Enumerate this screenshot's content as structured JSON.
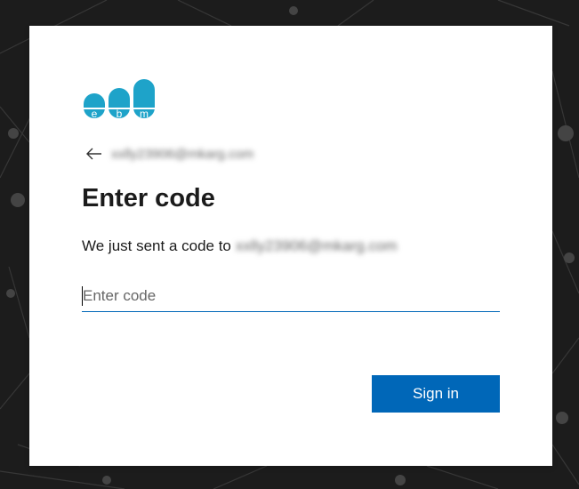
{
  "brand": {
    "logo_letters": [
      "e",
      "b",
      "m"
    ],
    "logo_color": "#1ea3c9"
  },
  "back": {
    "icon": "arrow-left-icon",
    "identity": "xxlly23906@mkarg.com"
  },
  "heading": "Enter code",
  "message": {
    "text": "We just sent a code to",
    "email": "xxlly23906@mkarg.com"
  },
  "code_input": {
    "placeholder": "Enter code",
    "value": ""
  },
  "signin_button": {
    "label": "Sign in",
    "color": "#0067b8"
  }
}
